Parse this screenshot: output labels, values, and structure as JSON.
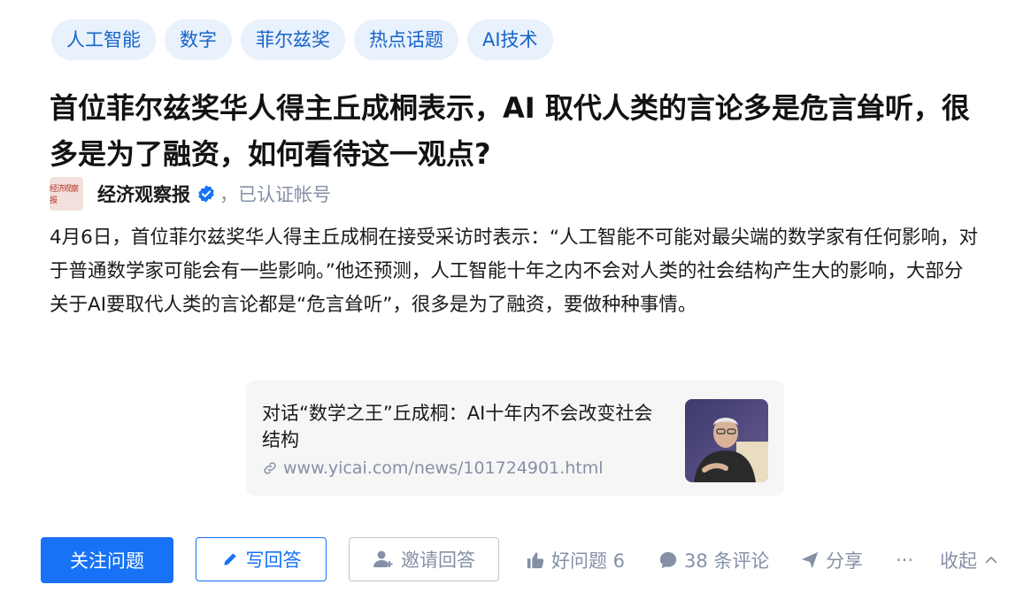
{
  "tags": [
    "人工智能",
    "数字",
    "菲尔兹奖",
    "热点话题",
    "AI技术"
  ],
  "question_title": "首位菲尔兹奖华人得主丘成桐表示，AI 取代人类的言论多是危言耸听，很多是为了融资，如何看待这一观点?",
  "author": {
    "avatar_text": "经济观察报",
    "name": "经济观察报",
    "cert_text": "，已认证帐号"
  },
  "content": "4月6日，首位菲尔兹奖华人得主丘成桐在接受采访时表示：“人工智能不可能对最尖端的数学家有任何影响，对于普通数学家可能会有一些影响。”他还预测，人工智能十年之内不会对人类的社会结构产生大的影响，大部分关于AI要取代人类的言论都是“危言耸听”，很多是为了融资，要做种种事情。",
  "link_card": {
    "title": "对话“数学之王”丘成桐：AI十年内不会改变社会结构",
    "url": "www.yicai.com/news/101724901.html"
  },
  "actions": {
    "follow": "关注问题",
    "write_answer": "写回答",
    "invite": "邀请回答",
    "good_question": "好问题 6",
    "comments": "38 条评论",
    "share": "分享",
    "more": "···",
    "collapse": "收起"
  },
  "colors": {
    "accent": "#1772f6",
    "tag_bg": "#e8f1fc",
    "muted": "#8590a6"
  }
}
